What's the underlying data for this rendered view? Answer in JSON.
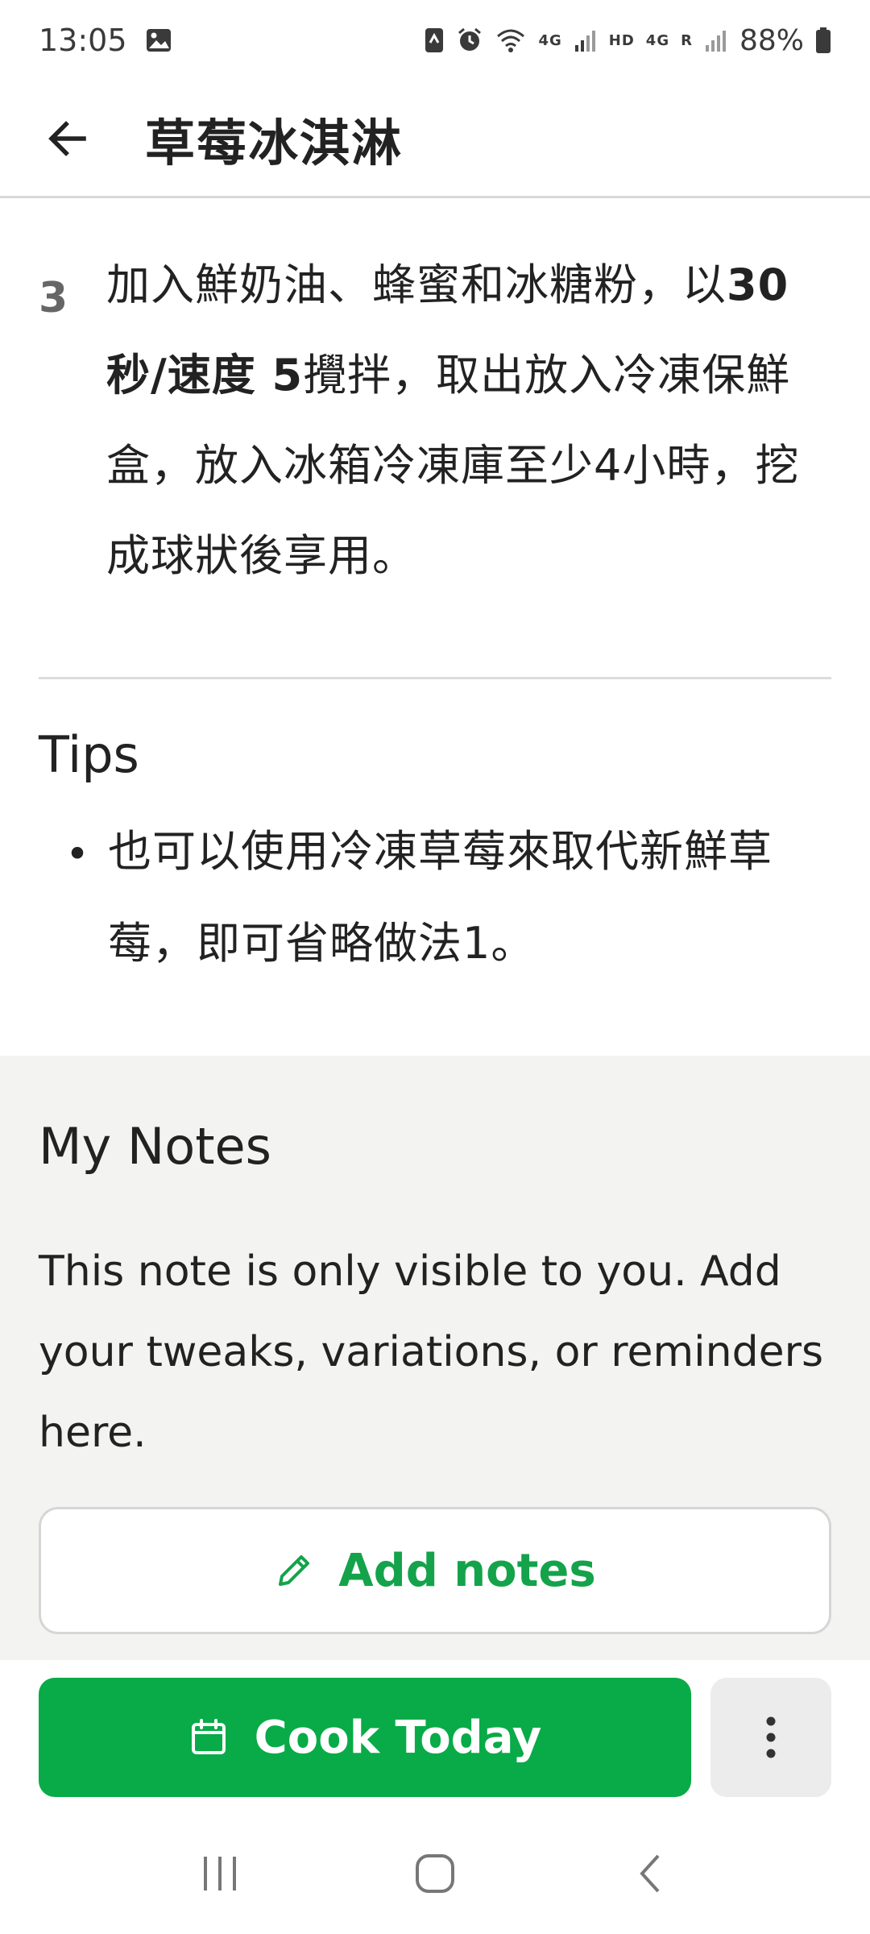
{
  "status_bar": {
    "time": "13:05",
    "network_4g_a": "4G",
    "network_hd": "HD",
    "network_4g_b": "4G",
    "roaming": "R",
    "battery": "88%"
  },
  "app_bar": {
    "title": "草莓冰淇淋"
  },
  "step": {
    "number": "3",
    "text_part1": "加入鮮奶油、蜂蜜和冰糖粉，以",
    "text_bold": "30 秒/速度 5",
    "text_part2": "攪拌，取出放入冷凍保鮮盒，放入冰箱冷凍庫至少4小時，挖成球狀後享用。"
  },
  "tips": {
    "title": "Tips",
    "items": [
      "也可以使用冷凍草莓來取代新鮮草莓，即可省略做法1。"
    ]
  },
  "notes": {
    "title": "My Notes",
    "description": "This note is only visible to you. Add your tweaks, variations, or reminders here.",
    "add_button": "Add notes"
  },
  "actions": {
    "cook_today": "Cook Today"
  },
  "colors": {
    "primary_green": "#08ab47",
    "link_green": "#14a34a",
    "notes_bg": "#f3f4f2"
  }
}
